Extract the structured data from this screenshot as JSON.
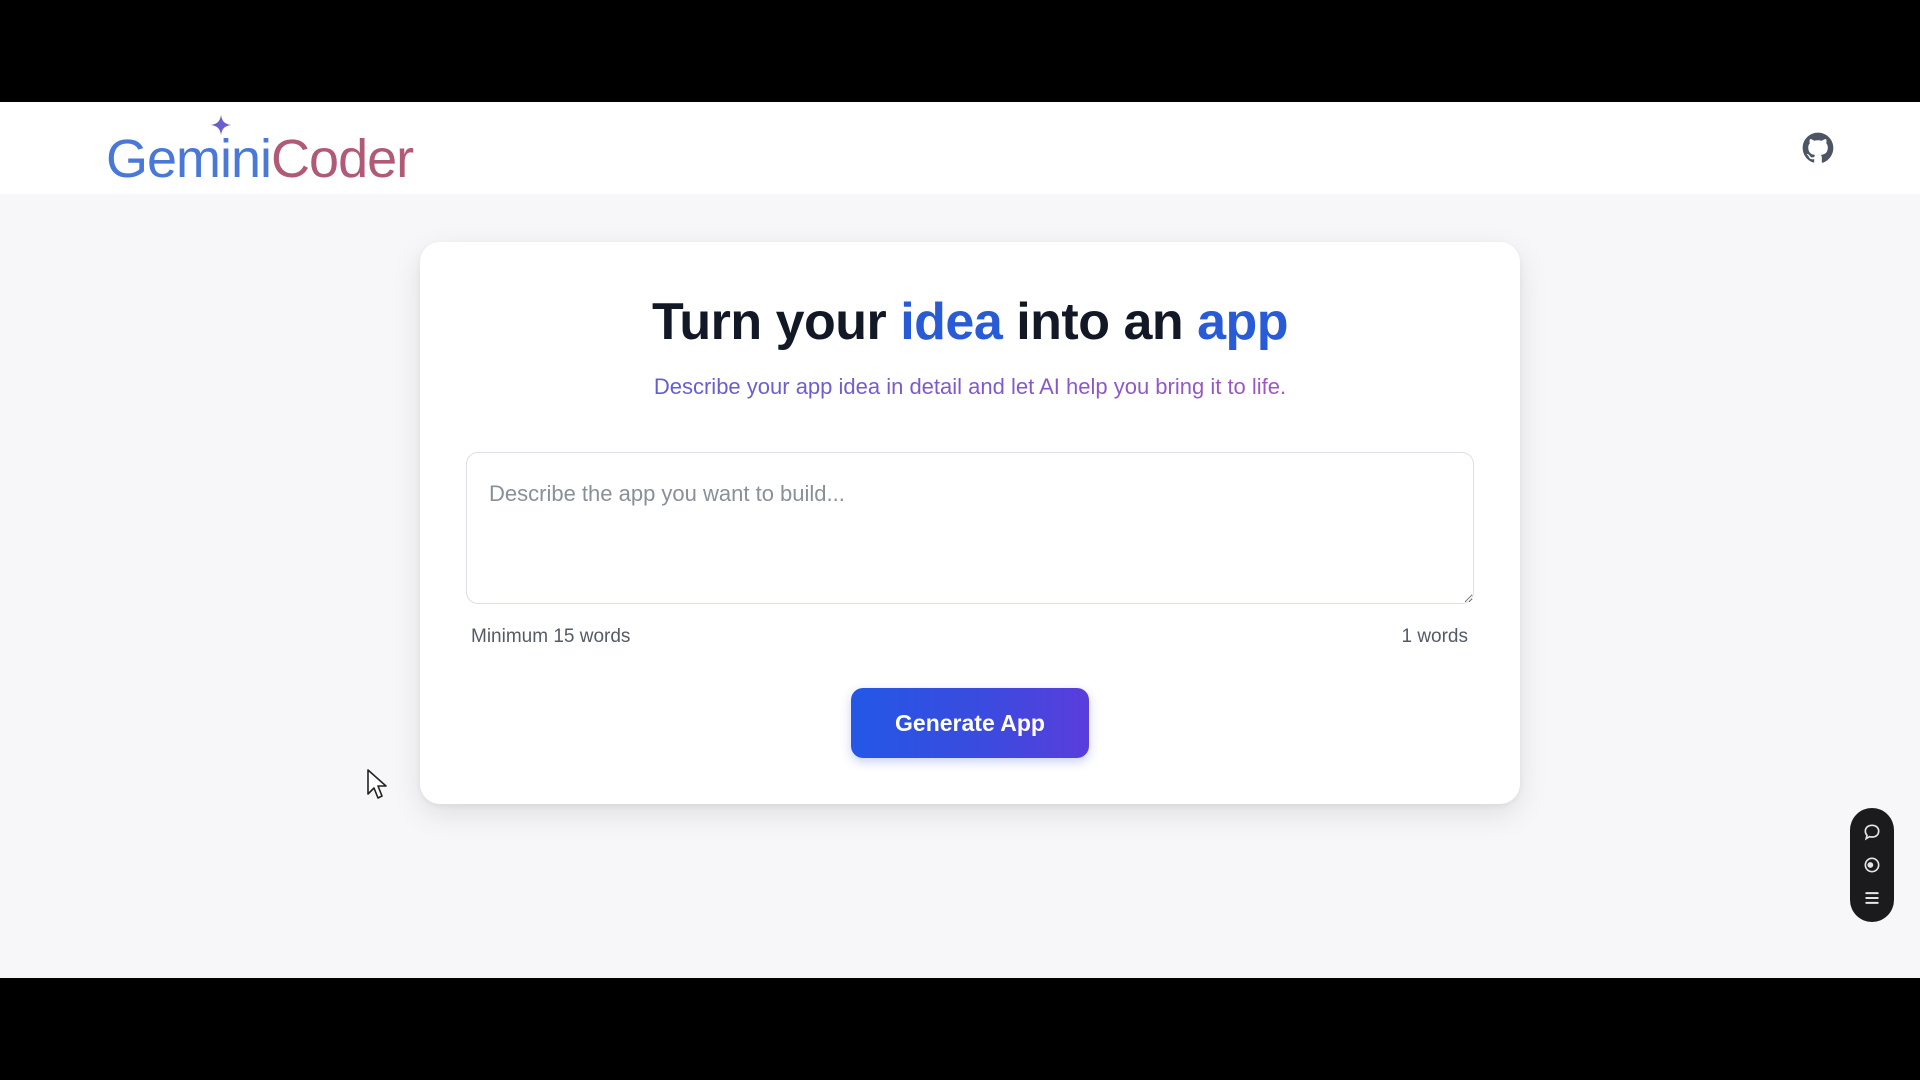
{
  "header": {
    "logo": {
      "part1": "Gemini",
      "part2": "Coder"
    },
    "github_icon": "github-icon"
  },
  "card": {
    "title": {
      "t1": "Turn your ",
      "h1": "idea",
      "t2": " into an ",
      "h2": "app"
    },
    "subtitle": "Describe your app idea in detail and let AI help you bring it to life.",
    "prompt": {
      "placeholder": "Describe the app you want to build...",
      "value": ""
    },
    "min_label": "Minimum 15 words",
    "word_count": "1 words",
    "generate_label": "Generate App"
  },
  "dock": {
    "items": [
      "chat-bubble-icon",
      "record-icon",
      "menu-icon"
    ]
  },
  "colors": {
    "accent": "#2a5bd7",
    "button_start": "#2457e6",
    "button_end": "#5a3ddc",
    "logo_blue": "#4a78d6",
    "logo_pink": "#b05a78"
  }
}
